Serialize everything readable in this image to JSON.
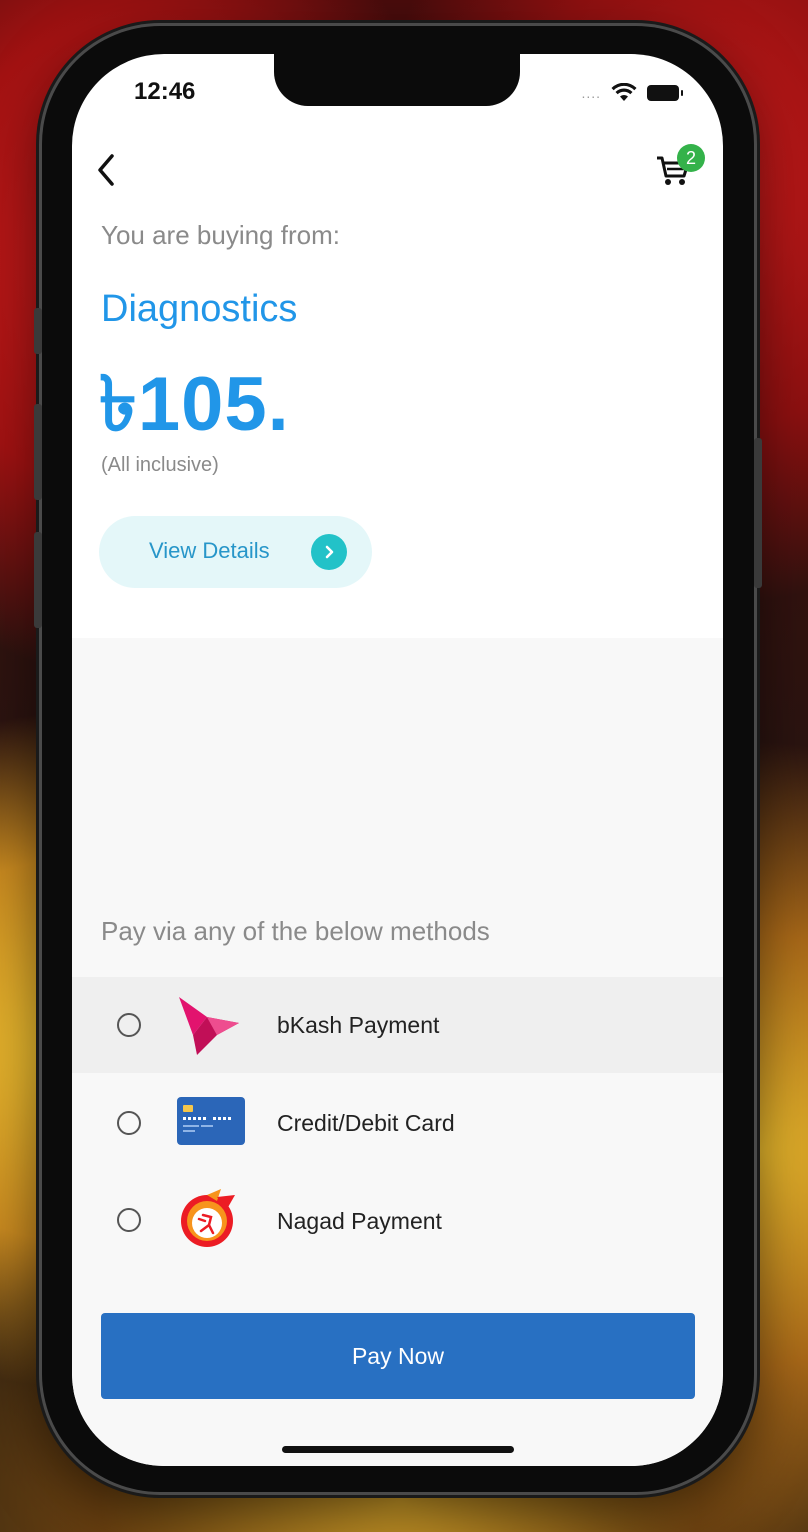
{
  "status_bar": {
    "time": "12:46",
    "signal_dots": "....",
    "wifi_icon": "wifi-icon",
    "battery_icon": "battery-icon"
  },
  "header": {
    "back_icon": "chevron-left-icon",
    "cart_icon": "cart-icon",
    "cart_count": "2"
  },
  "summary": {
    "buying_from_label": "You are buying from:",
    "merchant_name": "Diagnostics",
    "price": "৳105.",
    "price_note": "(All inclusive)",
    "view_details_label": "View Details"
  },
  "payment": {
    "heading": "Pay via any of the below methods",
    "methods": [
      {
        "label": "bKash Payment",
        "icon": "bkash-logo-icon",
        "selected": false
      },
      {
        "label": "Credit/Debit Card",
        "icon": "credit-card-icon",
        "selected": false
      },
      {
        "label": "Nagad Payment",
        "icon": "nagad-logo-icon",
        "selected": false
      }
    ],
    "pay_button_label": "Pay Now"
  },
  "colors": {
    "accent_blue": "#2196e8",
    "pay_button": "#2870c2",
    "badge_green": "#34b24a",
    "view_details_bg": "#e4f7f9",
    "view_details_arrow": "#22c2c8"
  }
}
